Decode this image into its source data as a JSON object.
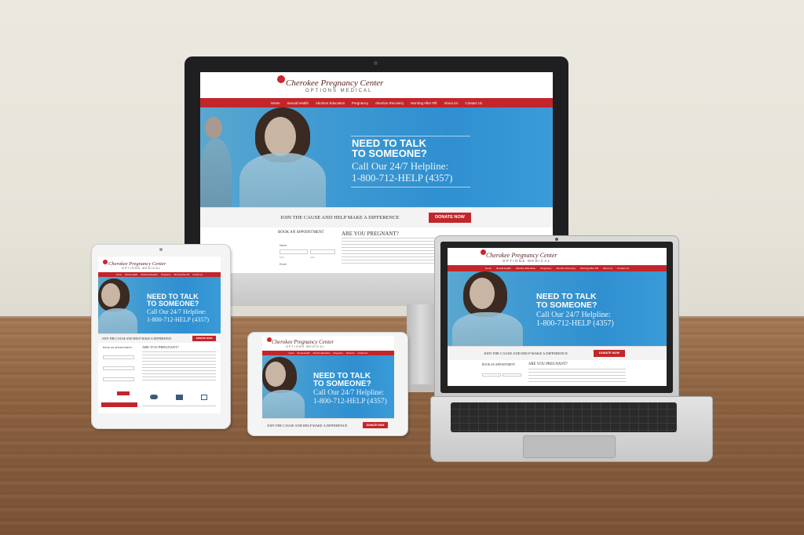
{
  "site": {
    "logo": "Cherokee Pregnancy Center",
    "logo_sub": "OPTIONS MEDICAL",
    "nav": [
      "Home",
      "Sexual Health",
      "Abortion Education",
      "Pregnancy",
      "Abortion Recovery",
      "Morning After Pill",
      "About Us",
      "Contact Us"
    ],
    "hero_heading_1": "NEED TO TALK",
    "hero_heading_2": "TO SOMEONE?",
    "hero_sub_1": "Call Our 24/7 Helpline:",
    "hero_sub_2": "1-800-712-HELP (4357)",
    "cause_text": "JOIN THE CAUSE AND HELP MAKE A DIFFERENCE",
    "donate_label": "DONATE NOW",
    "book_heading": "BOOK AN APPOINTMENT",
    "pregnant_heading": "ARE YOU PREGNANT?",
    "field_name": "Name",
    "field_first": "First",
    "field_last": "Last",
    "field_email": "Email"
  },
  "colors": {
    "nav_red": "#c2262b",
    "hero_blue": "#3f9ad2"
  }
}
